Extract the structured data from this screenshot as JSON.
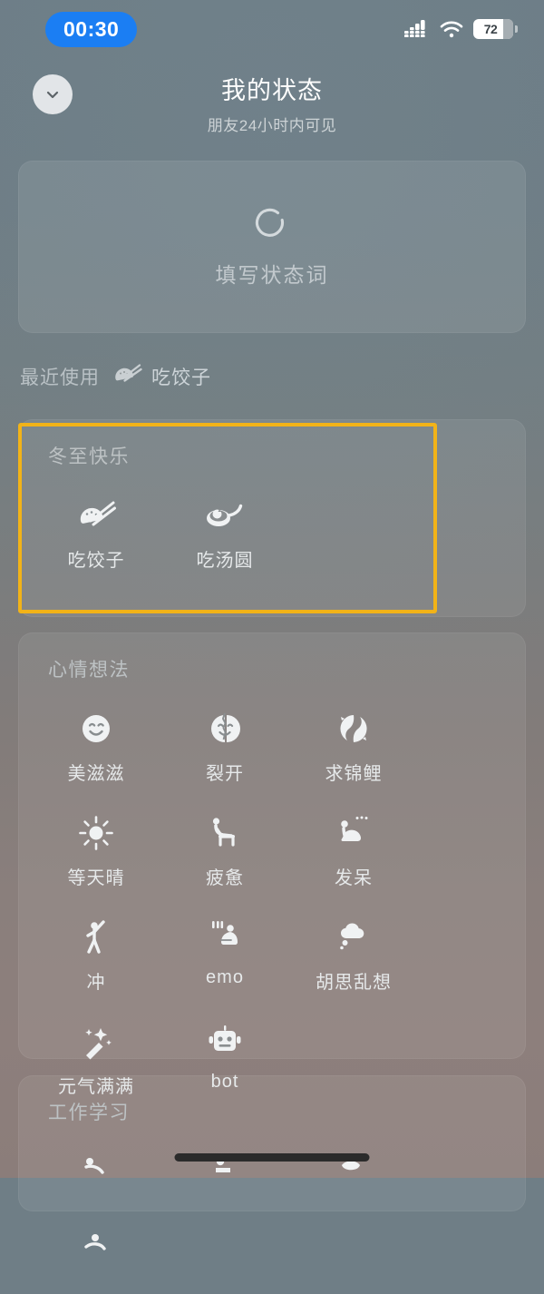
{
  "status_bar": {
    "time": "00:30",
    "battery_level": "72",
    "signal_icon": "cellular-signal-icon",
    "wifi_icon": "wifi-icon",
    "battery_icon": "battery-icon",
    "time_pill_color": "#1b7ef3"
  },
  "header": {
    "back_icon": "chevron-down-icon",
    "title": "我的状态",
    "subtitle": "朋友24小时内可见"
  },
  "input_card": {
    "icon": "emoji-ring-placeholder-icon",
    "placeholder": "填写状态词"
  },
  "recent": {
    "label": "最近使用",
    "item": {
      "icon": "dumpling-chopsticks-icon",
      "label": "吃饺子"
    }
  },
  "sections": [
    {
      "id": "winter",
      "title": "冬至快乐",
      "highlighted": true,
      "items": [
        {
          "icon": "dumpling-chopsticks-icon",
          "label": "吃饺子"
        },
        {
          "icon": "tangyuan-spoon-icon",
          "label": "吃汤圆"
        }
      ]
    },
    {
      "id": "mood",
      "title": "心情想法",
      "highlighted": false,
      "items": [
        {
          "icon": "smiling-face-icon",
          "label": "美滋滋"
        },
        {
          "icon": "cracked-face-icon",
          "label": "裂开"
        },
        {
          "icon": "koi-fish-icon",
          "label": "求锦鲤"
        },
        {
          "icon": "sun-icon",
          "label": "等天晴"
        },
        {
          "icon": "tired-person-icon",
          "label": "疲惫"
        },
        {
          "icon": "daydreaming-person-icon",
          "label": "发呆"
        },
        {
          "icon": "person-raising-arm-icon",
          "label": "冲"
        },
        {
          "icon": "crouching-person-icon",
          "label": "emo"
        },
        {
          "icon": "thought-cloud-icon",
          "label": "胡思乱想"
        },
        {
          "icon": "magic-wand-sparkle-icon",
          "label": "元气满满"
        },
        {
          "icon": "robot-head-icon",
          "label": "bot"
        }
      ]
    },
    {
      "id": "work",
      "title": "工作学习",
      "highlighted": false,
      "items": []
    }
  ],
  "annotation": {
    "color": "#f2b318",
    "target_section": "冬至快乐"
  },
  "home_indicator": "home-indicator-bar"
}
